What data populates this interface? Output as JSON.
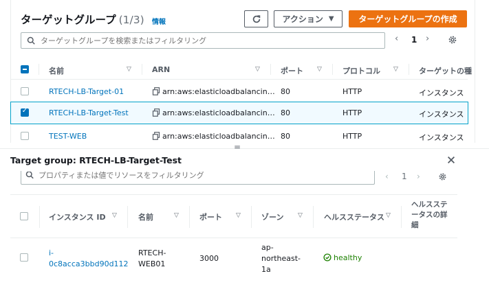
{
  "target_groups": {
    "title": "ターゲットグループ",
    "count": "(1/3)",
    "info_link": "情報",
    "actions_label": "アクション",
    "create_label": "ターゲットグループの作成",
    "search_placeholder": "ターゲットグループを検索またはフィルタリング",
    "page_number": "1",
    "columns": [
      "名前",
      "ARN",
      "ポート",
      "プロトコル",
      "ターゲットの種"
    ],
    "rows": [
      {
        "name": "RTECH-LB-Target-01",
        "arn": "arn:aws:elasticloadbalancin…",
        "port": "80",
        "protocol": "HTTP",
        "target_type": "インスタンス",
        "selected": false
      },
      {
        "name": "RTECH-LB-Target-Test",
        "arn": "arn:aws:elasticloadbalancin…",
        "port": "80",
        "protocol": "HTTP",
        "target_type": "インスタンス",
        "selected": true
      },
      {
        "name": "TEST-WEB",
        "arn": "arn:aws:elasticloadbalancin…",
        "port": "80",
        "protocol": "HTTP",
        "target_type": "インスタンス",
        "selected": false
      }
    ]
  },
  "split_divider": "=",
  "detail": {
    "title": "Target group: RTECH-LB-Target-Test",
    "search_placeholder": "プロパティまたは値でリソースをフィルタリング",
    "page_number": "1",
    "columns": {
      "instance_id": "インスタンス ID",
      "name": "名前",
      "port": "ポート",
      "zone": "ゾーン",
      "health_status": "ヘルスステータス",
      "health_detail": "ヘルスステータスの詳細"
    },
    "row": {
      "instance_id_line1": "i-",
      "instance_id_line2": "0c8acca3bbd90d112",
      "name_line1": "RTECH-",
      "name_line2": "WEB01",
      "port": "3000",
      "zone_line1": "ap-",
      "zone_line2": "northeast-",
      "zone_line3": "1a",
      "health": "healthy"
    }
  },
  "colors": {
    "primary": "#ec7211",
    "link": "#0073bb",
    "selected_border": "#00a1c9",
    "healthy": "#1d8102"
  }
}
